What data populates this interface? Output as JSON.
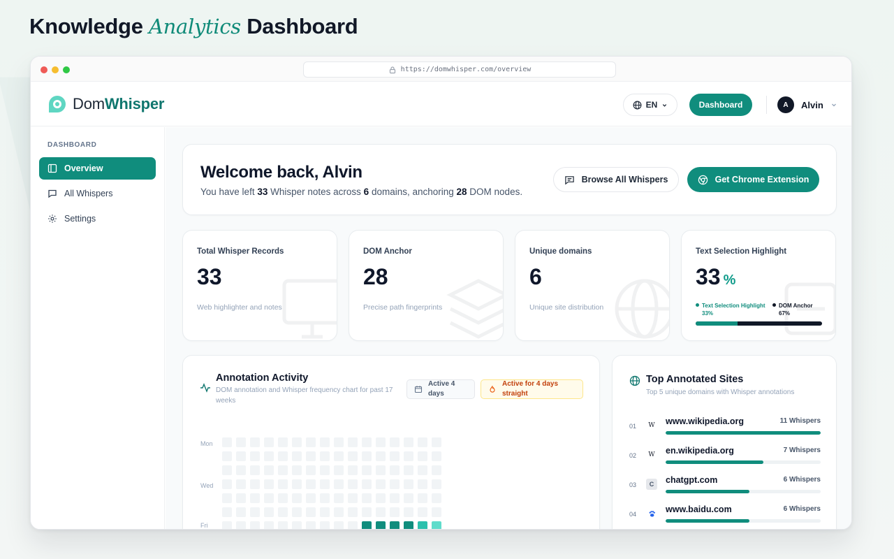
{
  "headline": {
    "part1": "Knowledge",
    "part2": "Analytics",
    "part3": "Dashboard"
  },
  "browser": {
    "url": "https://domwhisper.com/overview"
  },
  "header": {
    "logo_plain": "Dom",
    "logo_bold": "Whisper",
    "language": "EN",
    "dashboard_label": "Dashboard",
    "user_initial": "A",
    "user_name": "Alvin"
  },
  "sidebar": {
    "section_title": "DASHBOARD",
    "items": [
      {
        "label": "Overview",
        "icon": "layout-icon",
        "active": true
      },
      {
        "label": "All Whispers",
        "icon": "message-icon",
        "active": false
      },
      {
        "label": "Settings",
        "icon": "gear-icon",
        "active": false
      }
    ]
  },
  "welcome": {
    "title": "Welcome back, Alvin",
    "sub_1": "You have left ",
    "notes": "33",
    "sub_2": " Whisper notes across ",
    "domains": "6",
    "sub_3": " domains, anchoring ",
    "nodes": "28",
    "sub_4": " DOM nodes.",
    "browse_label": "Browse All Whispers",
    "extension_label": "Get Chrome Extension"
  },
  "stats": [
    {
      "label": "Total Whisper Records",
      "value": "33",
      "desc": "Web highlighter and notes"
    },
    {
      "label": "DOM Anchor",
      "value": "28",
      "desc": "Precise path fingerprints"
    },
    {
      "label": "Unique domains",
      "value": "6",
      "desc": "Unique site distribution"
    },
    {
      "label": "Text Selection Highlight",
      "value": "33",
      "unit": "%",
      "legend": [
        {
          "name": "Text Selection Highlight",
          "value": "33%",
          "color": "#108d7d"
        },
        {
          "name": "DOM Anchor",
          "value": "67%",
          "color": "#111827"
        }
      ],
      "ratio": 0.33
    }
  ],
  "activity": {
    "title": "Annotation Activity",
    "subtitle": "DOM annotation and Whisper frequency chart for past 17 weeks",
    "active_days": "Active 4 days",
    "streak": "Active for 4 days straight",
    "day_labels": [
      "Mon",
      "Wed",
      "Fri"
    ],
    "weeks": 16,
    "active_cells": [
      {
        "week": 10,
        "day": 6,
        "color": "#108d7d"
      },
      {
        "week": 11,
        "day": 6,
        "color": "#108d7d"
      },
      {
        "week": 12,
        "day": 6,
        "color": "#108d7d"
      },
      {
        "week": 13,
        "day": 6,
        "color": "#108d7d"
      },
      {
        "week": 14,
        "day": 6,
        "color": "#2cc0ad"
      },
      {
        "week": 15,
        "day": 6,
        "color": "#5fdccb"
      }
    ]
  },
  "sites": {
    "title": "Top Annotated Sites",
    "subtitle": "Top 5 unique domains with Whisper annotations",
    "items": [
      {
        "rank": "01",
        "favicon": "W",
        "name": "www.wikipedia.org",
        "count": "11 Whispers",
        "ratio": 1.0
      },
      {
        "rank": "02",
        "favicon": "W",
        "name": "en.wikipedia.org",
        "count": "7 Whispers",
        "ratio": 0.63
      },
      {
        "rank": "03",
        "favicon": "C",
        "name": "chatgpt.com",
        "count": "6 Whispers",
        "ratio": 0.54
      },
      {
        "rank": "04",
        "favicon": "paw-icon",
        "name": "www.baidu.com",
        "count": "6 Whispers",
        "ratio": 0.54
      }
    ]
  }
}
